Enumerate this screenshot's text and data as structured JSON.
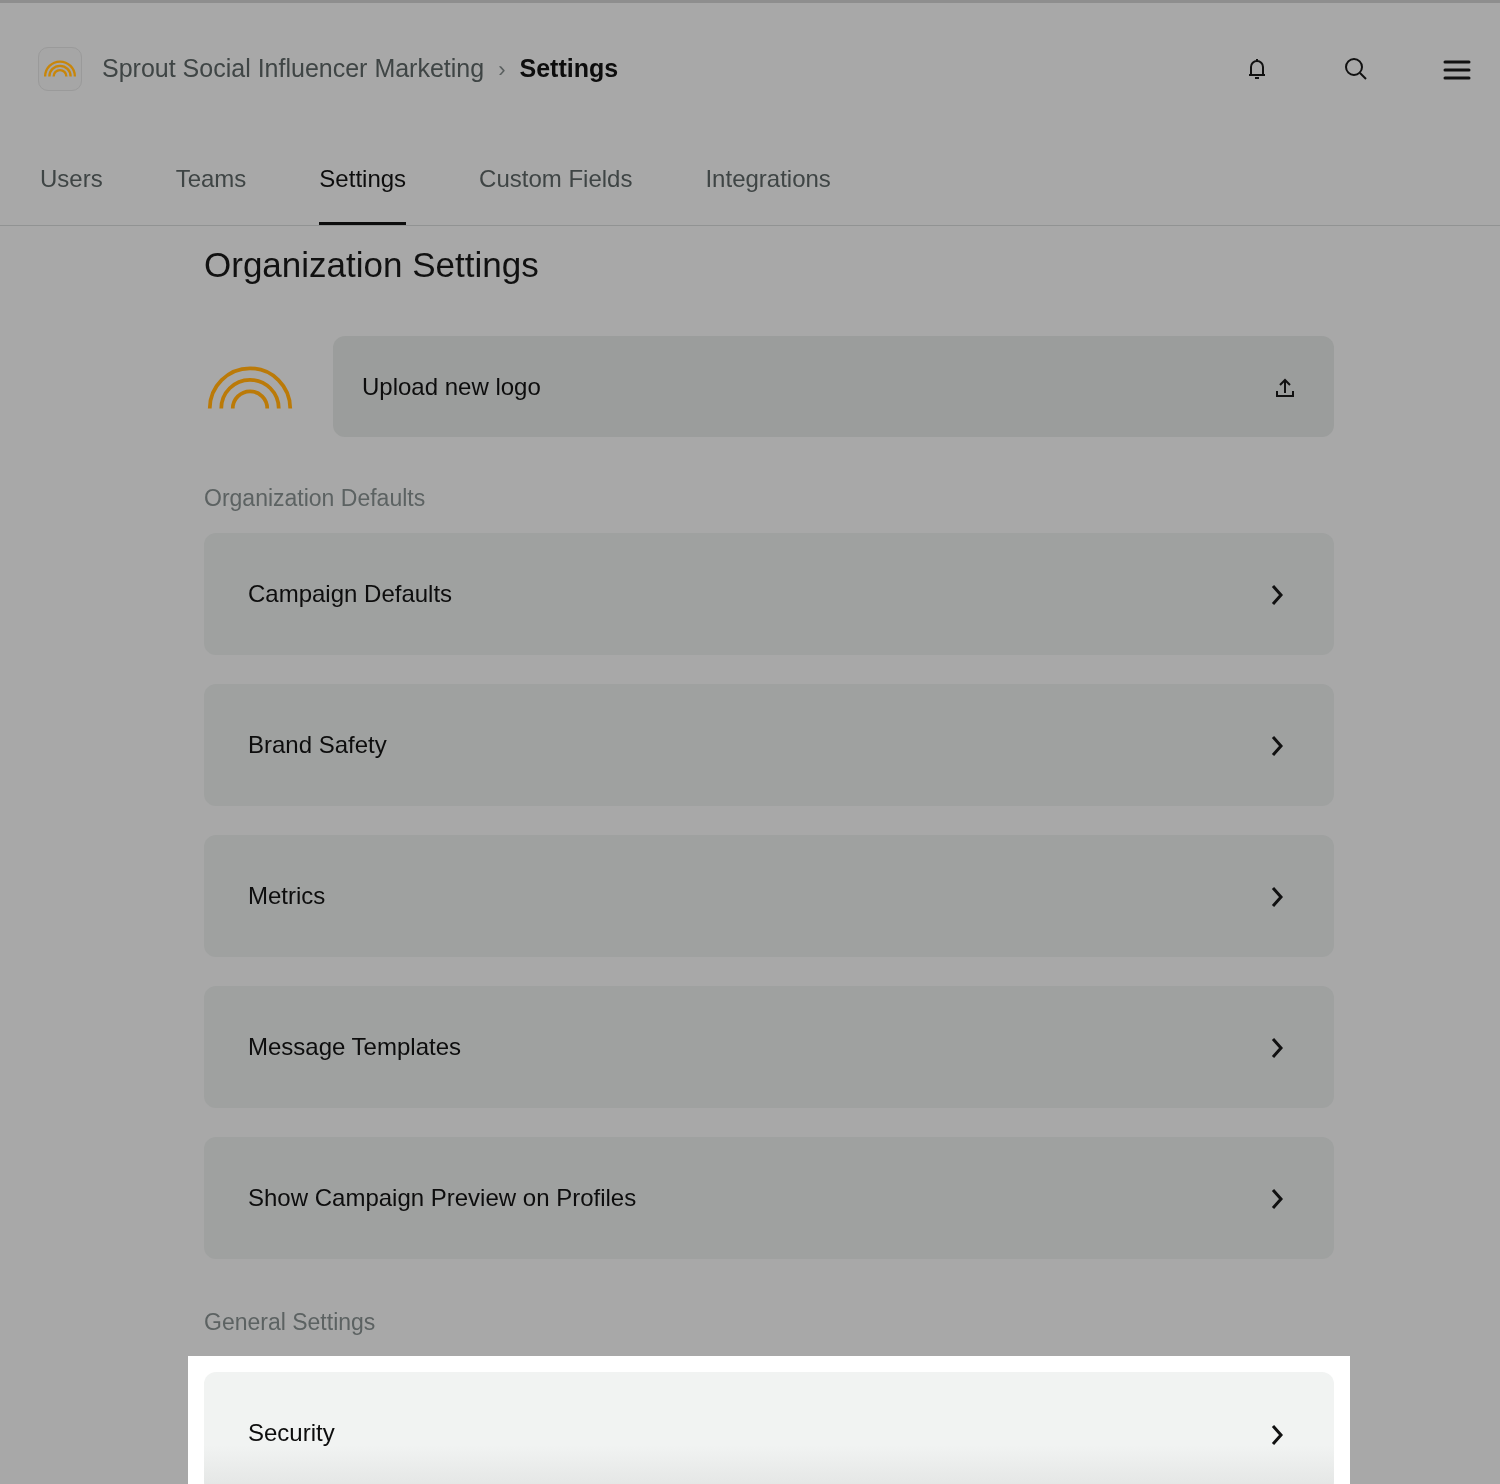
{
  "header": {
    "app_name": "Sprout Social Influencer Marketing",
    "separator": "›",
    "current": "Settings"
  },
  "tabs": [
    {
      "label": "Users",
      "selected": false
    },
    {
      "label": "Teams",
      "selected": false
    },
    {
      "label": "Settings",
      "selected": true
    },
    {
      "label": "Custom Fields",
      "selected": false
    },
    {
      "label": "Integrations",
      "selected": false
    }
  ],
  "page_title": "Organization Settings",
  "logo_upload": {
    "label": "Upload new logo"
  },
  "sections": [
    {
      "title": "Organization Defaults",
      "items": [
        {
          "label": "Campaign Defaults",
          "highlighted": false
        },
        {
          "label": "Brand Safety",
          "highlighted": false
        },
        {
          "label": "Metrics",
          "highlighted": false
        },
        {
          "label": "Message Templates",
          "highlighted": false
        },
        {
          "label": "Show Campaign Preview on Profiles",
          "highlighted": false
        }
      ]
    },
    {
      "title": "General Settings",
      "items": [
        {
          "label": "Security",
          "highlighted": true
        }
      ]
    }
  ]
}
